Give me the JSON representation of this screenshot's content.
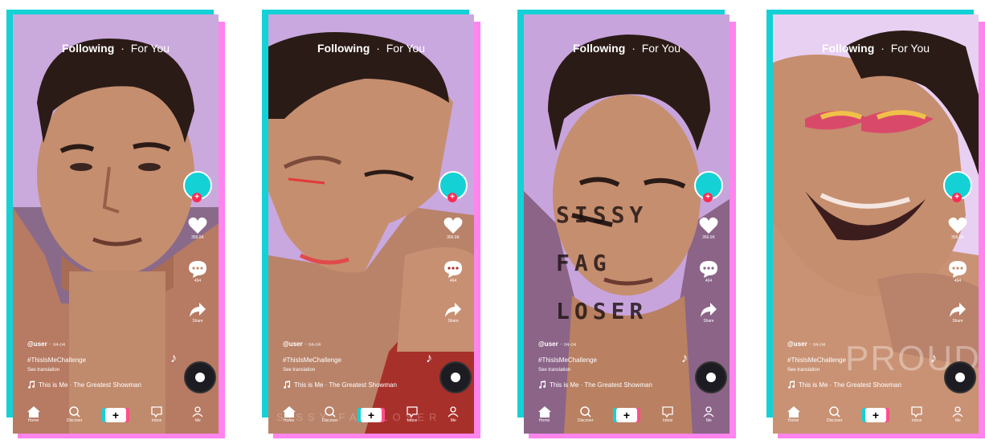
{
  "screens": [
    {
      "top_nav": {
        "following": "Following",
        "separator": "·",
        "for_you": "For You"
      },
      "likes": "356.9K",
      "comments": "464",
      "share": "Share",
      "user": "@user",
      "date": "04-04",
      "hashtag": "#ThisIsMeChallenge",
      "see_translation": "See translation",
      "song": "This is Me · The Greatest Showman",
      "nav": {
        "home": "Home",
        "discover": "Discover",
        "inbox": "Inbox",
        "me": "Me"
      }
    },
    {
      "top_nav": {
        "following": "Following",
        "separator": "·",
        "for_you": "For You"
      },
      "likes": "356.9K",
      "comments": "464",
      "share": "Share",
      "user": "@user",
      "date": "04-04",
      "hashtag": "#ThisIsMeChallenge",
      "see_translation": "See translation",
      "song": "This is Me · The Greatest Showman",
      "overlay": "SISSY FAG LOSER",
      "nav": {
        "home": "Home",
        "discover": "Discover",
        "inbox": "Inbox",
        "me": "Me"
      }
    },
    {
      "top_nav": {
        "following": "Following",
        "separator": "·",
        "for_you": "For You"
      },
      "likes": "356.9K",
      "comments": "464",
      "share": "Share",
      "user": "@user",
      "date": "04-04",
      "hashtag": "#ThisIsMeChallenge",
      "see_translation": "See translation",
      "song": "This is Me · The Greatest Showman",
      "overlay": "SISSY FAG LOSER",
      "nav": {
        "home": "Home",
        "discover": "Discover",
        "inbox": "Inbox",
        "me": "Me"
      }
    },
    {
      "top_nav": {
        "following": "Following",
        "separator": "·",
        "for_you": "For You"
      },
      "likes": "356.9K",
      "comments": "464",
      "share": "Share",
      "user": "@user",
      "date": "04-04",
      "hashtag": "#ThisIsMeChallenge",
      "see_translation": "See translation",
      "song": "This is Me · The Greatest Showman",
      "overlay": "PROUD",
      "nav": {
        "home": "Home",
        "discover": "Discover",
        "inbox": "Inbox",
        "me": "Me"
      }
    }
  ],
  "colors": {
    "cyan": "#14d1d6",
    "pink": "#ff84ee",
    "red": "#fe2c55",
    "skin": "#c58e6f",
    "hair": "#2b1b16"
  },
  "icons": [
    "heart-icon",
    "comment-icon",
    "share-icon",
    "home-icon",
    "search-icon",
    "inbox-icon",
    "profile-icon",
    "music-note-icon",
    "disc-icon"
  ]
}
